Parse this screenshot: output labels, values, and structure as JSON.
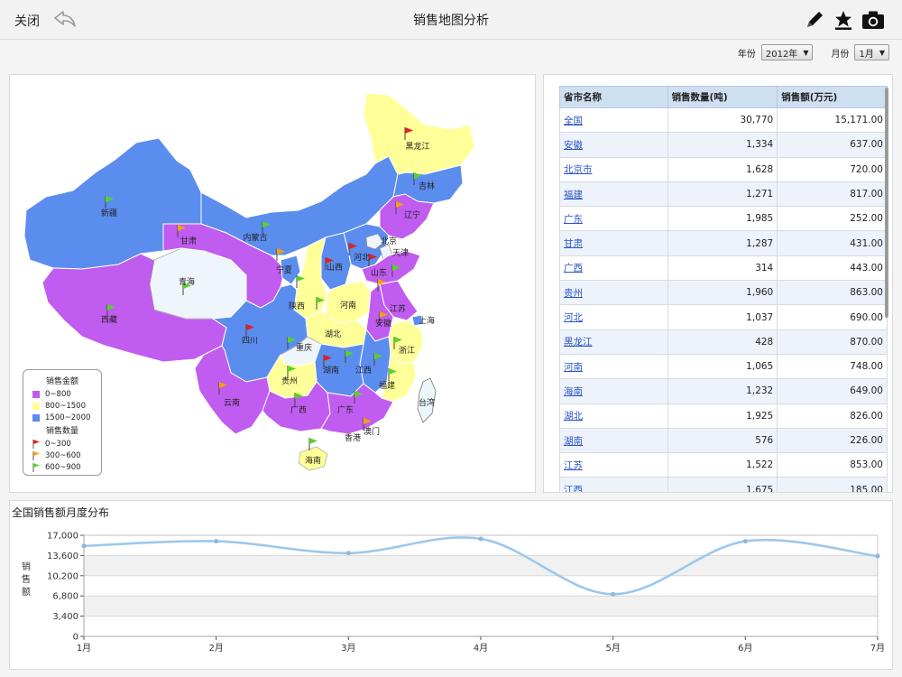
{
  "header": {
    "close_label": "关闭",
    "title": "销售地图分析",
    "icons": [
      "back-arrow-icon",
      "pencil-icon",
      "star-download-icon",
      "camera-icon"
    ]
  },
  "filters": {
    "year_label": "年份",
    "year_value": "2012年",
    "month_label": "月份",
    "month_value": "1月"
  },
  "map": {
    "region_labels": [
      "黑龙江",
      "吉林",
      "辽宁",
      "内蒙古",
      "新疆",
      "甘肃",
      "青海",
      "宁夏",
      "陕西",
      "山西",
      "河北",
      "北京",
      "天津",
      "山东",
      "河南",
      "江苏",
      "上海",
      "安徽",
      "湖北",
      "西藏",
      "四川",
      "重庆",
      "浙江",
      "湖南",
      "江西",
      "贵州",
      "福建",
      "云南",
      "广西",
      "广东",
      "澳门",
      "香港",
      "台湾",
      "海南"
    ],
    "colors": {
      "amount_low": "#c05cf0",
      "amount_mid": "#ffff99",
      "amount_high": "#5b8def",
      "other": "#eef6fb",
      "flag_low": "#e02020",
      "flag_mid": "#f2a20c",
      "flag_high": "#5ad12a"
    },
    "legend": {
      "amount_title": "销售金额",
      "amount_items": [
        "0~800",
        "800~1500",
        "1500~2000"
      ],
      "count_title": "销售数量",
      "count_items": [
        "0~300",
        "300~600",
        "600~900"
      ]
    }
  },
  "table": {
    "columns": [
      "省市名称",
      "销售数量(吨)",
      "销售额(万元)"
    ],
    "rows": [
      {
        "name": "全国",
        "qty": "30,770",
        "amount": "15,171.00"
      },
      {
        "name": "安徽",
        "qty": "1,334",
        "amount": "637.00"
      },
      {
        "name": "北京市",
        "qty": "1,628",
        "amount": "720.00"
      },
      {
        "name": "福建",
        "qty": "1,271",
        "amount": "817.00"
      },
      {
        "name": "广东",
        "qty": "1,985",
        "amount": "252.00"
      },
      {
        "name": "甘肃",
        "qty": "1,287",
        "amount": "431.00"
      },
      {
        "name": "广西",
        "qty": "314",
        "amount": "443.00"
      },
      {
        "name": "贵州",
        "qty": "1,960",
        "amount": "863.00"
      },
      {
        "name": "河北",
        "qty": "1,037",
        "amount": "690.00"
      },
      {
        "name": "黑龙江",
        "qty": "428",
        "amount": "870.00"
      },
      {
        "name": "河南",
        "qty": "1,065",
        "amount": "748.00"
      },
      {
        "name": "海南",
        "qty": "1,232",
        "amount": "649.00"
      },
      {
        "name": "湖北",
        "qty": "1,925",
        "amount": "826.00"
      },
      {
        "name": "湖南",
        "qty": "576",
        "amount": "226.00"
      },
      {
        "name": "江苏",
        "qty": "1,522",
        "amount": "853.00"
      },
      {
        "name": "江西",
        "qty": "1,675",
        "amount": "185.00"
      }
    ]
  },
  "chart": {
    "title": "全国销售额月度分布",
    "ylabel": "销售额",
    "line_color": "#9cc8ec"
  },
  "chart_data": {
    "type": "line",
    "title": "全国销售额月度分布",
    "xlabel": "",
    "ylabel": "销售额",
    "categories": [
      "1月",
      "2月",
      "3月",
      "4月",
      "5月",
      "6月",
      "7月"
    ],
    "series": [
      {
        "values": [
          15200,
          16000,
          14000,
          16400,
          7100,
          16000,
          13500
        ]
      }
    ],
    "yticks": [
      "0",
      "3,400",
      "6,800",
      "10,200",
      "13,600",
      "17,000"
    ],
    "ylim": [
      0,
      17000
    ],
    "grid": true
  }
}
